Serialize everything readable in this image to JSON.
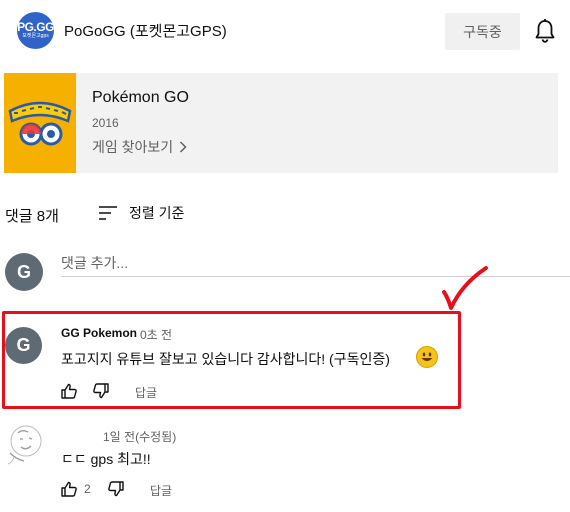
{
  "channel": {
    "logo_text": "PG.GG",
    "logo_subtext": "포켓몬고gps",
    "name": "PoGoGG (포켓몬고GPS)",
    "subscribe_label": "구독중"
  },
  "game": {
    "thumbnail_text": "POKÉMON GO",
    "title": "Pokémon GO",
    "year": "2016",
    "browse_label": "게임 찾아보기"
  },
  "comments_header": {
    "count_label": "댓글 8개",
    "sort_label": "정렬 기준"
  },
  "add_comment": {
    "avatar_letter": "G",
    "placeholder": "댓글 추가..."
  },
  "comments": [
    {
      "avatar_letter": "G",
      "author": "GG Pokemon",
      "time": "0초 전",
      "text": "포고지지 유튜브 잘보고 있습니다 감사합니다! (구독인증)",
      "reply_label": "답글",
      "emoji": "smiling-face-emoji"
    },
    {
      "time": "1일 전(수정됨)",
      "text": "ㄷㄷ gps 최고!!",
      "likes": "2",
      "reply_label": "답글"
    }
  ],
  "colors": {
    "annotation_red": "#e5101c",
    "thumbnail_yellow": "#f6b100",
    "channel_logo_blue": "#2f63c8"
  }
}
